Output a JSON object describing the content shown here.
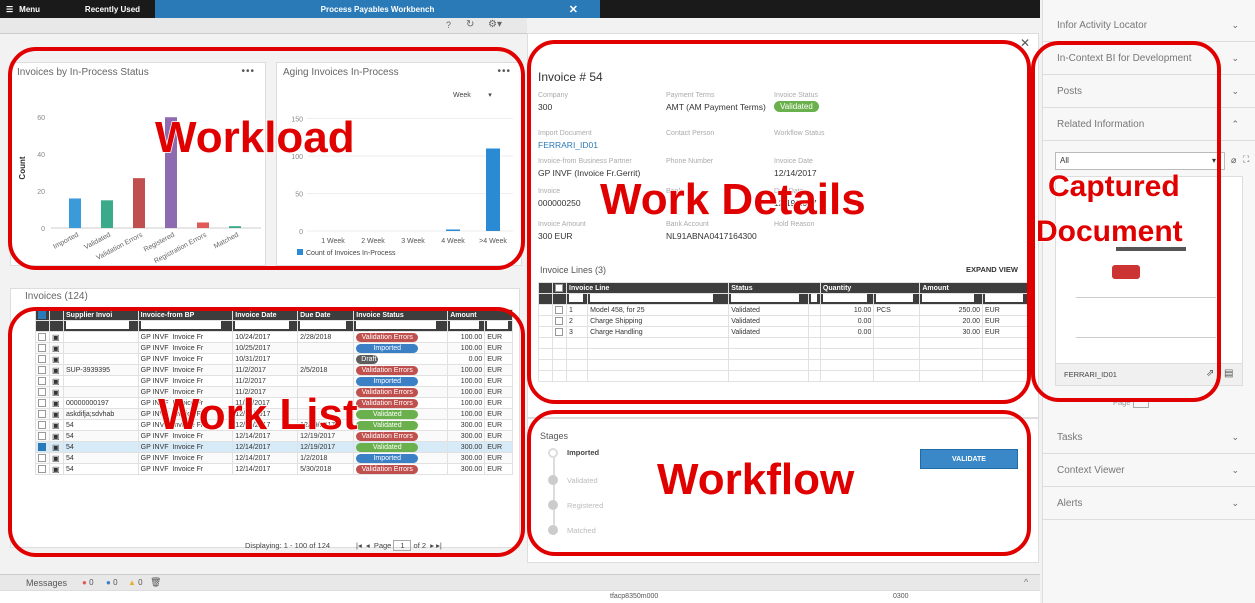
{
  "topbar": {
    "menu": "Menu",
    "tab_recent": "Recently Used",
    "tab_active": "Process Payables Workbench"
  },
  "chart1": {
    "title": "Invoices by In-Process Status",
    "ylabel": "Count",
    "yticks": [
      "60",
      "40",
      "20",
      "0"
    ],
    "categories": [
      "Imported",
      "Validated",
      "Validation Errors",
      "Registered",
      "Registration Errors",
      "Matched"
    ],
    "values": [
      16,
      15,
      27,
      60,
      3,
      1
    ],
    "colors": [
      "#3b9ad9",
      "#3aaa8a",
      "#c0504d",
      "#8e6bb0",
      "#e05a5a",
      "#3aaa8a"
    ]
  },
  "chart2": {
    "title": "Aging Invoices In-Process",
    "period": "Week",
    "yticks": [
      "150",
      "100",
      "50",
      "0"
    ],
    "categories": [
      "1 Week",
      "2 Week",
      "3 Week",
      "4 Week",
      ">4 Week"
    ],
    "values": [
      0,
      0,
      0,
      2,
      110
    ],
    "legend": "Count of Invoices In-Process",
    "color": "#2a8ad4"
  },
  "worklist": {
    "title": "Invoices (124)",
    "columns": [
      "Supplier Invoi",
      "Invoice-from BP",
      "Invoice Date",
      "Due Date",
      "Invoice Status",
      "Amount"
    ],
    "rows": [
      [
        "",
        "GP INVF",
        "Invoice Fr",
        "10/24/2017",
        "2/28/2018",
        "Validation Errors",
        "100.00",
        "EUR"
      ],
      [
        "",
        "GP INVF",
        "Invoice Fr",
        "10/25/2017",
        "",
        "Imported",
        "100.00",
        "EUR"
      ],
      [
        "",
        "GP INVF",
        "Invoice Fr",
        "10/31/2017",
        "",
        "Draft",
        "0.00",
        "EUR"
      ],
      [
        "SUP-3939395",
        "GP INVF",
        "Invoice Fr",
        "11/2/2017",
        "2/5/2018",
        "Validation Errors",
        "100.00",
        "EUR"
      ],
      [
        "",
        "GP INVF",
        "Invoice Fr",
        "11/2/2017",
        "",
        "Imported",
        "100.00",
        "EUR"
      ],
      [
        "",
        "GP INVF",
        "Invoice Fr",
        "11/2/2017",
        "",
        "Validation Errors",
        "100.00",
        "EUR"
      ],
      [
        "00000000197",
        "GP INVF",
        "Invoice Fr",
        "11/30/2017",
        "",
        "Validation Errors",
        "100.00",
        "EUR"
      ],
      [
        "askdifja;sdvhab",
        "GP INVF",
        "Invoice Fr",
        "12/14/2017",
        "",
        "Validated",
        "100.00",
        "EUR"
      ],
      [
        "54",
        "GP INVF",
        "Invoice Fr",
        "12/14/2017",
        "12/19/2017",
        "Validated",
        "300.00",
        "EUR"
      ],
      [
        "54",
        "GP INVF",
        "Invoice Fr",
        "12/14/2017",
        "12/19/2017",
        "Validation Errors",
        "300.00",
        "EUR"
      ],
      [
        "54",
        "GP INVF",
        "Invoice Fr",
        "12/14/2017",
        "12/19/2017",
        "Validated",
        "300.00",
        "EUR"
      ],
      [
        "54",
        "GP INVF",
        "Invoice Fr",
        "12/14/2017",
        "1/2/2018",
        "Imported",
        "300.00",
        "EUR"
      ],
      [
        "54",
        "GP INVF",
        "Invoice Fr",
        "12/14/2017",
        "5/30/2018",
        "Validation Errors",
        "300.00",
        "EUR"
      ]
    ],
    "selected_row": 10,
    "footer": "Displaying: 1 - 100 of 124",
    "page_label": "Page",
    "page": "1",
    "of": "of 2"
  },
  "details": {
    "title": "Invoice # 54",
    "fields": [
      {
        "l": "Company",
        "v": "300"
      },
      {
        "l": "Payment Terms",
        "v": "AMT (AM Payment Terms)"
      },
      {
        "l": "Invoice Status",
        "v": "Validated"
      },
      {
        "l": "Import Document",
        "v": "FERRARI_ID01"
      },
      {
        "l": "Contact Person",
        "v": ""
      },
      {
        "l": "Workflow Status",
        "v": ""
      },
      {
        "l": "Invoice-from Business Partner",
        "v": "GP INVF (Invoice Fr.Gerrit)"
      },
      {
        "l": "Phone Number",
        "v": ""
      },
      {
        "l": "Invoice Date",
        "v": "12/14/2017"
      },
      {
        "l": "Invoice",
        "v": "000000250"
      },
      {
        "l": "Bank",
        "v": ""
      },
      {
        "l": "Due Date",
        "v": "12/19/2017"
      },
      {
        "l": "Invoice Amount",
        "v": "300 EUR"
      },
      {
        "l": "Bank Account",
        "v": "NL91ABNA0417164300"
      },
      {
        "l": "Hold Reason",
        "v": ""
      }
    ],
    "lines_title": "Invoice Lines (3)",
    "expand": "EXPAND VIEW",
    "line_columns": [
      "Invoice Line",
      "Status",
      "Quantity",
      "Amount"
    ],
    "lines": [
      [
        "1",
        "Model 458, for 25",
        "Validated",
        "10.00",
        "PCS",
        "250.00",
        "EUR"
      ],
      [
        "2",
        "Charge Shipping",
        "Validated",
        "0.00",
        "",
        "20.00",
        "EUR"
      ],
      [
        "3",
        "Charge Handling",
        "Validated",
        "0.00",
        "",
        "30.00",
        "EUR"
      ]
    ]
  },
  "workflow": {
    "title": "Stages",
    "stages": [
      "Imported",
      "Validated",
      "Registered",
      "Matched"
    ],
    "validate": "VALIDATE"
  },
  "right_panel": {
    "items_top": [
      "Infor Activity Locator",
      "In-Context BI for Development",
      "Posts",
      "Related Information"
    ],
    "filter": "All",
    "doc_name": "FERRARI_ID01",
    "page": "Page",
    "items_bottom": [
      "Tasks",
      "Context Viewer",
      "Alerts"
    ]
  },
  "messages": {
    "label": "Messages",
    "errors": "0",
    "info": "0",
    "warnings": "0"
  },
  "statusbar": {
    "program": "tfacp8350m000",
    "company": "0300"
  },
  "overlays": {
    "workload": "Workload",
    "worklist": "Work List",
    "details": "Work Details",
    "workflow": "Workflow",
    "captured1": "Captured",
    "captured2": "Document"
  }
}
